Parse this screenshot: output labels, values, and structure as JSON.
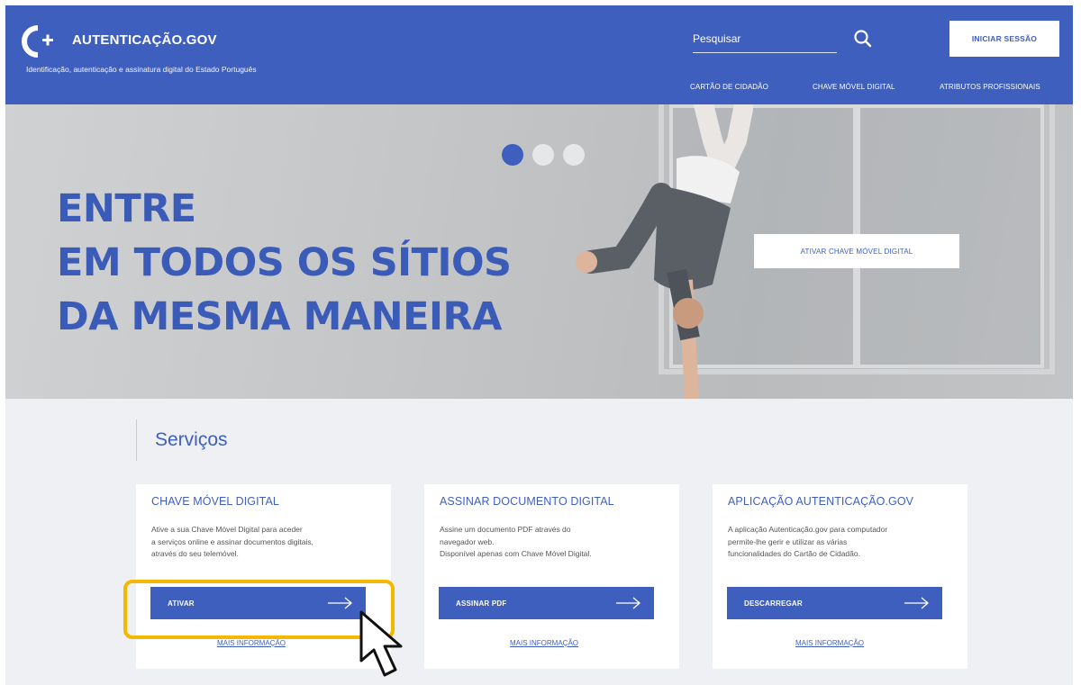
{
  "header": {
    "brand": "AUTENTICAÇÃO.GOV",
    "tagline": "Identificação, autenticação e assinatura digital do Estado Português",
    "search_placeholder": "Pesquisar",
    "login_label": "INICIAR SESSÃO",
    "nav": [
      "CARTÃO DE CIDADÃO",
      "CHAVE MÓVEL DIGITAL",
      "ATRIBUTOS PROFISSIONAIS"
    ],
    "brand_color": "#3f5fbf"
  },
  "hero": {
    "heading_lines": [
      "ENTRE",
      "EM TODOS OS SÍTIOS",
      "DA MESMA MANEIRA"
    ],
    "cta_label": "ATIVAR CHAVE MÓVEL DIGITAL",
    "active_slide": 1,
    "slide_count": 3
  },
  "services": {
    "title": "Serviços",
    "cards": [
      {
        "title": "CHAVE MÓVEL DIGITAL",
        "text": "Ative a sua Chave Móvel Digital para aceder\na serviços online e assinar documentos digitais,\natravés do seu telemóvel.",
        "button": "ATIVAR",
        "link": "MAIS INFORMAÇÃO"
      },
      {
        "title": "ASSINAR DOCUMENTO DIGITAL",
        "text": "Assine um documento PDF através do\nnavegador web.\nDisponível apenas com Chave Móvel Digital.",
        "button": "ASSINAR PDF",
        "link": "MAIS INFORMAÇÃO"
      },
      {
        "title": "APLICAÇÃO AUTENTICAÇÃO.GOV",
        "text": "A aplicação Autenticação.gov para computador\npermite-lhe gerir e utilizar as várias\nfuncionalidades do Cartão de Cidadão.",
        "button": "DESCARREGAR",
        "link": "MAIS INFORMAÇÃO"
      }
    ]
  },
  "annotation": {
    "highlight_color": "#f5b800"
  }
}
